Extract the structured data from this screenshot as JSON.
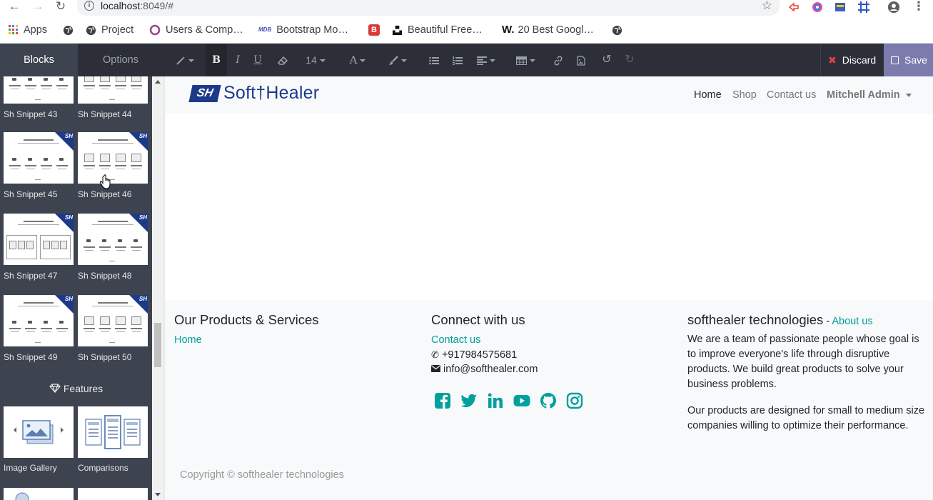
{
  "browser": {
    "url_host": "localhost",
    "url_rest": ":8049/#",
    "bookmarks": [
      {
        "label": "Apps",
        "icon": "apps-grid-icon"
      },
      {
        "label": "",
        "icon": "globe-icon"
      },
      {
        "label": "Project",
        "icon": "globe-icon"
      },
      {
        "label": "Users & Comp…",
        "icon": "odoo-circle-icon"
      },
      {
        "label": "Bootstrap Mo…",
        "icon": "mdb-icon"
      },
      {
        "label": "Beautiful Free…",
        "icon": "b-square-icon"
      },
      {
        "label": "",
        "icon": "unsplash-icon"
      },
      {
        "label": "20 Best Googl…",
        "icon": "w-logo-icon"
      },
      {
        "label": "",
        "icon": "globe-icon"
      }
    ]
  },
  "editor": {
    "tab_blocks": "Blocks",
    "tab_options": "Options",
    "font_size": "14",
    "discard_label": "Discard",
    "save_label": "Save"
  },
  "sidebar": {
    "snippets": [
      {
        "label": "Sh Snippet 43"
      },
      {
        "label": "Sh Snippet 44"
      },
      {
        "label": "Sh Snippet 45"
      },
      {
        "label": "Sh Snippet 46"
      },
      {
        "label": "Sh Snippet 47"
      },
      {
        "label": "Sh Snippet 48"
      },
      {
        "label": "Sh Snippet 49"
      },
      {
        "label": "Sh Snippet 50"
      }
    ],
    "badge_text": "SH",
    "features_heading": "Features",
    "features": [
      {
        "label": "Image Gallery"
      },
      {
        "label": "Comparisons"
      }
    ]
  },
  "site": {
    "logo_mark": "SH",
    "logo_text": "Soft†Healer",
    "nav": {
      "home": "Home",
      "shop": "Shop",
      "contact": "Contact us",
      "user": "Mitchell Admin"
    },
    "footer": {
      "products_title": "Our Products & Services",
      "products_home": "Home",
      "connect_title": "Connect with us",
      "connect_contact": "Contact us",
      "phone": "+917984575681",
      "email": "info@softhealer.com",
      "company_title": "softhealer technologies",
      "company_sep": " - ",
      "about_link": "About us",
      "about_p1": "We are a team of passionate people whose goal is to improve everyone's life through disruptive products. We build great products to solve your business problems.",
      "about_p2": "Our products are designed for small to medium size companies willing to optimize their performance.",
      "copyright": "Copyright © softhealer technologies",
      "social": [
        "facebook-icon",
        "twitter-icon",
        "linkedin-icon",
        "youtube-icon",
        "github-icon",
        "instagram-icon"
      ]
    }
  },
  "colors": {
    "accent": "#00a09d",
    "save_bg": "#7c7bad",
    "toolbar_bg": "#2c2f38",
    "sidebar_bg": "#3e4350",
    "brand": "#1d3a8a"
  }
}
